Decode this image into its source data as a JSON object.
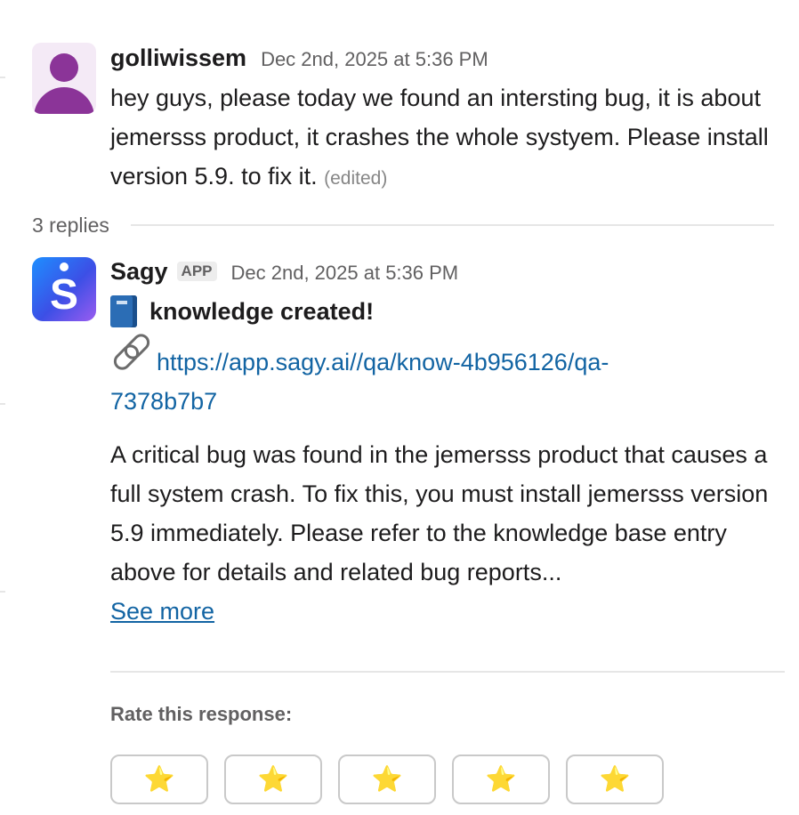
{
  "thread": {
    "parent": {
      "author": "golliwissem",
      "timestamp": "Dec 2nd, 2025 at 5:36 PM",
      "text": "hey guys, please today we found an intersting bug, it is about jemersss product, it crashes the whole systyem. Please install version 5.9. to fix it.",
      "edited_label": "(edited)",
      "avatar_icon": "user-silhouette-icon",
      "avatar_color": "#8b3498"
    },
    "replies_label": "3 replies",
    "reply": {
      "author": "Sagy",
      "badge": "APP",
      "timestamp": "Dec 2nd, 2025 at 5:36 PM",
      "avatar_letter": "S",
      "heading_icon": "book-icon",
      "heading": "knowledge created!",
      "link_icon": "link-icon",
      "url": "https://app.sagy.ai//qa/know-4b956126/qa-7378b7b7",
      "summary": "A critical bug was found in the jemersss product that causes a full system crash. To fix this, you must install jemersss version 5.9 immediately. Please refer to the knowledge base entry above for details and related bug reports...",
      "see_more": "See more",
      "rate_label": "Rate this response:",
      "rating_star": "⭐",
      "rating_buttons": 5
    }
  },
  "colors": {
    "link": "#1264a3",
    "text": "#1d1c1d",
    "muted": "#616061",
    "star": "#ffc83d"
  }
}
